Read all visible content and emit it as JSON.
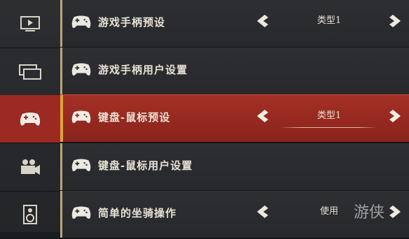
{
  "sidebar": {
    "items": [
      {
        "icon": "video-play-icon",
        "active": false
      },
      {
        "icon": "windows-icon",
        "active": false
      },
      {
        "icon": "gamepad-icon",
        "active": true
      },
      {
        "icon": "camera-icon",
        "active": false
      },
      {
        "icon": "speaker-icon",
        "active": false
      }
    ]
  },
  "settings": {
    "rows": [
      {
        "label": "游戏手柄预设",
        "value": "类型1",
        "has_selector": true,
        "active": false
      },
      {
        "label": "游戏手柄用户设置",
        "value": "",
        "has_selector": false,
        "active": false
      },
      {
        "label": "键盘-鼠标预设",
        "value": "类型1",
        "has_selector": true,
        "active": true
      },
      {
        "label": "键盘-鼠标用户设置",
        "value": "",
        "has_selector": false,
        "active": false
      },
      {
        "label": "简单的坐骑操作",
        "value": "使用",
        "has_selector": true,
        "active": false
      }
    ]
  },
  "watermark": {
    "text": "游侠"
  },
  "colors": {
    "active_row": "#9a2a22",
    "accent_bar": "#e0a33b",
    "text": "#e8e2d4"
  }
}
